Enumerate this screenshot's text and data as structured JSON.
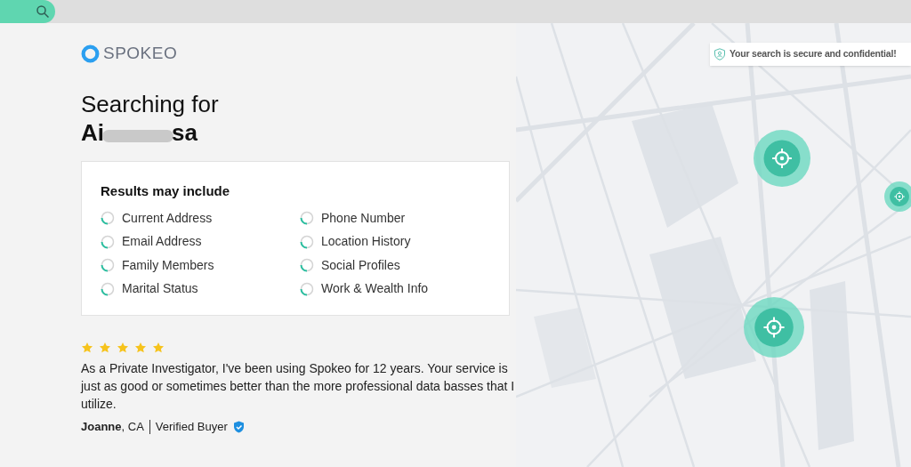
{
  "brand": {
    "name": "SPOKEO"
  },
  "heading": {
    "title": "Searching for",
    "name_start": "Ai",
    "name_end": "sa"
  },
  "results": {
    "title": "Results may include",
    "items": [
      {
        "label": "Current Address"
      },
      {
        "label": "Email Address"
      },
      {
        "label": "Family Members"
      },
      {
        "label": "Marital Status"
      },
      {
        "label": "Phone Number"
      },
      {
        "label": "Location History"
      },
      {
        "label": "Social Profiles"
      },
      {
        "label": "Work & Wealth Info"
      }
    ]
  },
  "review": {
    "stars": 5,
    "text": "As a Private Investigator, I've been using Spokeo for 12 years. Your service is just as good or sometimes better than the more professional data basses that I utilize.",
    "author": "Joanne",
    "location": ", CA",
    "badge": "Verified Buyer"
  },
  "secure_notice": "Your search is secure and confidential!"
}
